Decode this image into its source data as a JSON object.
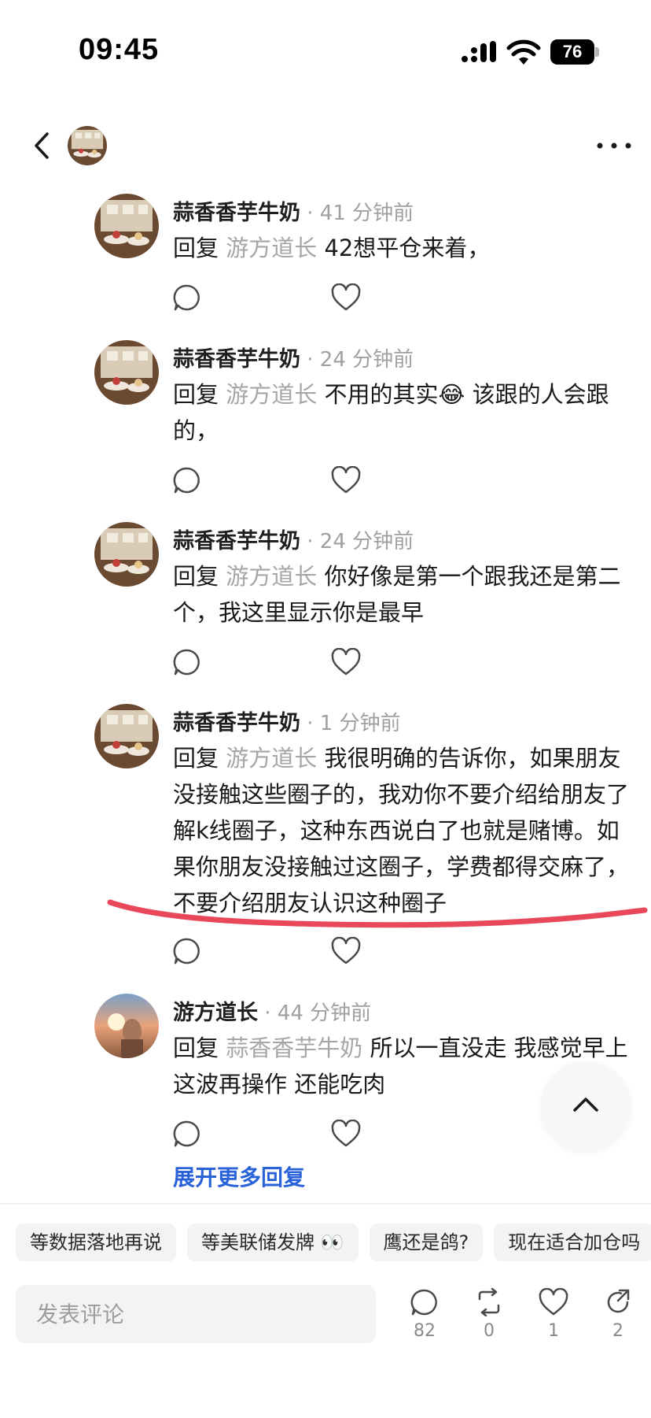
{
  "status_bar": {
    "time": "09:45",
    "battery": "76"
  },
  "comments": [
    {
      "author": "蒜香香芋牛奶",
      "ago": "41 分钟前",
      "reply_word": "回复",
      "mention": "游方道长",
      "text": "42想平仓来着，"
    },
    {
      "author": "蒜香香芋牛奶",
      "ago": "24 分钟前",
      "reply_word": "回复",
      "mention": "游方道长",
      "text": "不用的其实😂 该跟的人会跟的，"
    },
    {
      "author": "蒜香香芋牛奶",
      "ago": "24 分钟前",
      "reply_word": "回复",
      "mention": "游方道长",
      "text": "你好像是第一个跟我还是第二个，我这里显示你是最早"
    },
    {
      "author": "蒜香香芋牛奶",
      "ago": "1 分钟前",
      "reply_word": "回复",
      "mention": "游方道长",
      "text": "我很明确的告诉你，如果朋友没接触这些圈子的，我劝你不要介绍给朋友了解k线圈子，这种东西说白了也就是赌博。如果你朋友没接触过这圈子，学费都得交麻了，不要介绍朋友认识这种圈子"
    },
    {
      "author": "游方道长",
      "ago": "44 分钟前",
      "reply_word": "回复",
      "mention": "蒜香香芋牛奶",
      "text": "所以一直没走 我感觉早上这波再操作 还能吃肉"
    }
  ],
  "expand_more": "展开更多回复",
  "chips": [
    "等数据落地再说",
    "等美联储发牌 👀",
    "鹰还是鸽?",
    "现在适合加仓吗"
  ],
  "compose": {
    "placeholder": "发表评论"
  },
  "stats": {
    "comments": "82",
    "reposts": "0",
    "likes": "1",
    "shares": "2"
  },
  "colors": {
    "mention": "#a6a6a6",
    "link": "#2a62d9",
    "annotation": "#e8485a"
  }
}
